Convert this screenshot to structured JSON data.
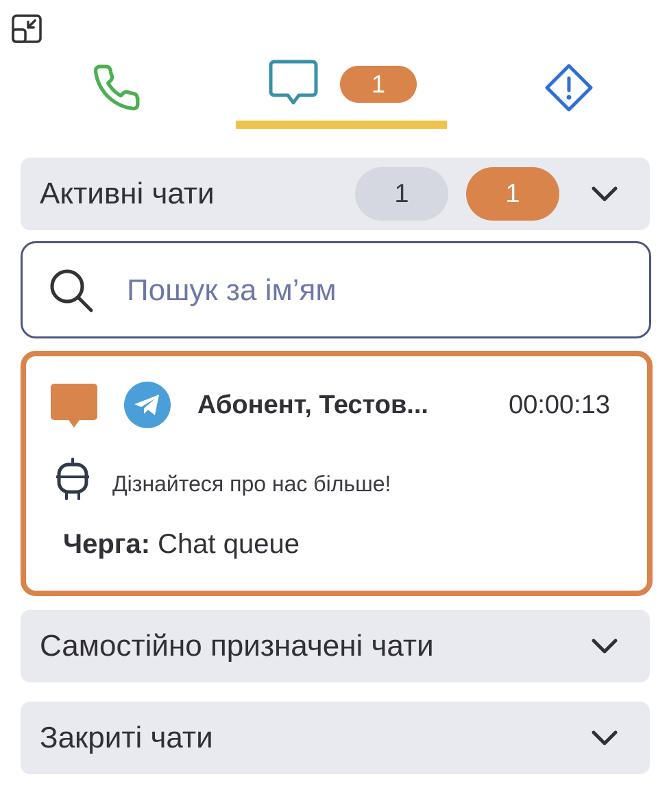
{
  "tabs": {
    "chat_badge": "1"
  },
  "active_chats": {
    "title": "Активні чати",
    "count_total": "1",
    "count_unread": "1"
  },
  "search": {
    "placeholder": "Пошук за ім’ям"
  },
  "chat_item": {
    "name": "Абонент, Тестов...",
    "timer": "00:00:13",
    "last_message": "Дізнайтеся про нас більше!",
    "queue_label": "Черга:",
    "queue_value": "Chat queue"
  },
  "self_assigned": {
    "title": "Самостійно призначені чати"
  },
  "closed_chats": {
    "title": "Закриті чати"
  },
  "colors": {
    "accent_orange": "#d9844a",
    "tab_underline": "#f0c24c",
    "phone_green": "#4caf50",
    "chat_teal": "#3a90a8",
    "alert_blue": "#2f6fd6",
    "telegram_blue": "#4a9fd8"
  },
  "icons": [
    "collapse-icon",
    "phone-icon",
    "chat-bubble-icon",
    "alert-diamond-icon",
    "chevron-down-icon",
    "search-icon",
    "telegram-icon",
    "robot-icon"
  ]
}
